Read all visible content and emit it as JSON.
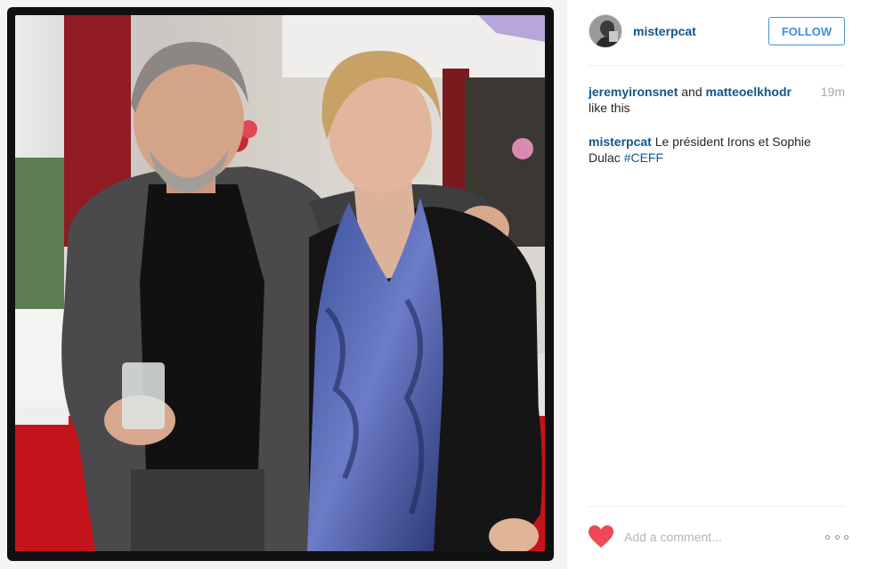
{
  "post": {
    "photo_alt": "Jeremy Irons and Sophie Dulac"
  },
  "header": {
    "username": "misterpcat",
    "follow_label": "FOLLOW"
  },
  "likes": {
    "user1": "jeremyironsnet",
    "conjunction": "and",
    "user2": "matteoelkhodr",
    "suffix": "like this",
    "time": "19m"
  },
  "caption": {
    "username": "misterpcat",
    "text": "Le président Irons et Sophie Dulac",
    "hashtag": "#CEFF"
  },
  "comment": {
    "placeholder": "Add a comment..."
  },
  "icons": {
    "heart": "heart-icon",
    "more": "more-options-icon"
  },
  "colors": {
    "link": "#125688",
    "follow_blue": "#3f8fd9",
    "heart_red": "#ed4956",
    "time_gray": "#a5a7aa"
  }
}
